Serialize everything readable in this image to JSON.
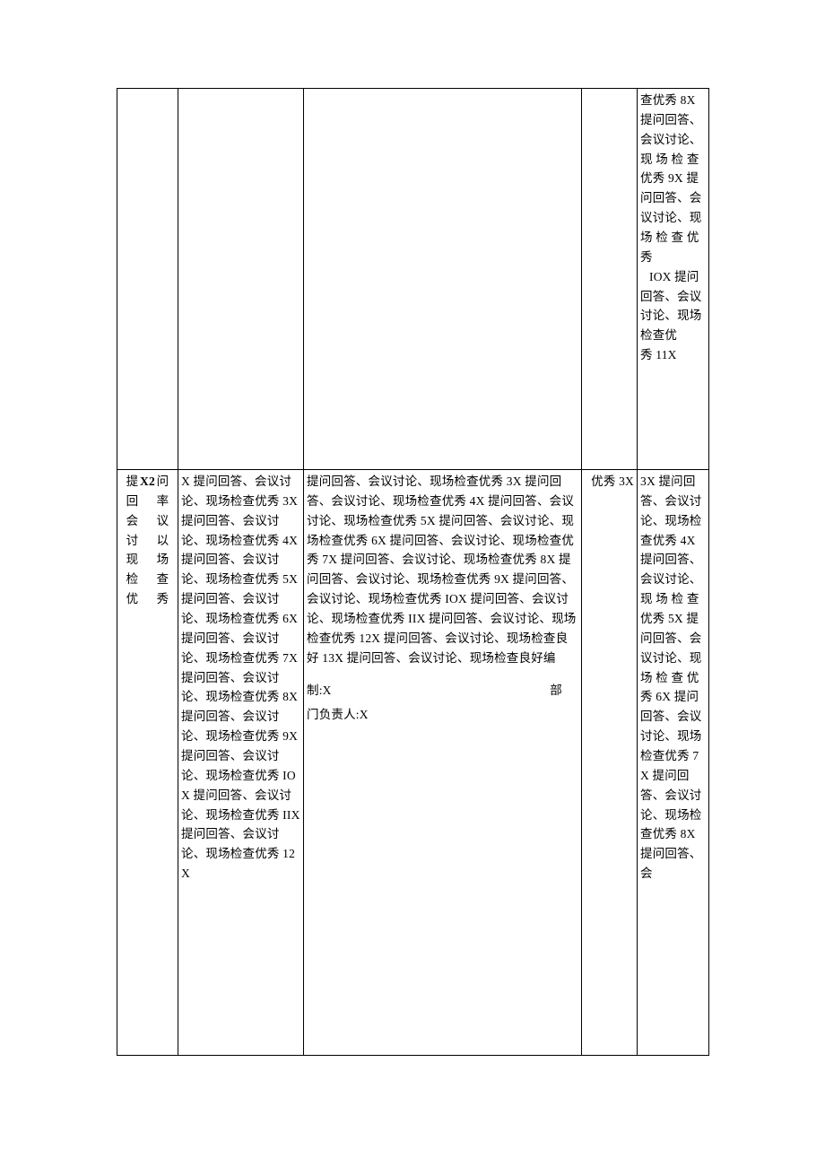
{
  "document": {
    "table": {
      "rows": [
        {
          "cells": {
            "col1": "",
            "col2": "",
            "col3": "",
            "col4": "",
            "col5_lines": [
              "查优秀 8X",
              "提问回答、",
              "会议讨论、",
              "现 场 检 查",
              "优秀 9X 提",
              "问回答、会",
              "议讨论、现",
              "场 检 查 优",
              "秀",
              "IOX 提问",
              "回答、会议",
              "讨论、现场",
              "检查优",
              "秀 11X"
            ]
          }
        },
        {
          "cells": {
            "col1_vertical": [
              "提回会讨现检优",
              "X2",
              "问率议以场查秀"
            ],
            "col2": "X 提问回答、会议讨论、现场检查优秀 3X 提问回答、会议讨论、现场检查优秀 4X 提问回答、会议讨论、现场检查优秀 5X 提问回答、会议讨论、现场检查优秀 6X 提问回答、会议讨论、现场检查优秀 7X 提问回答、会议讨论、现场检查优秀 8X 提问回答、会议讨论、现场检查优秀 9X 提问回答、会议讨论、现场检查优秀 IOX 提问回答、会议讨论、现场检查优秀 IIX 提问回答、会议讨论、现场检查优秀 12X",
            "col3": "提问回答、会议讨论、现场检查优秀 3X 提问回答、会议讨论、现场检查优秀 4X 提问回答、会议讨论、现场检查优秀 5X 提问回答、会议讨论、现场检查优秀 6X 提问回答、会议讨论、现场检查优秀 7X 提问回答、会议讨论、现场检查优秀 8X 提问回答、会议讨论、现场检查优秀 9X 提问回答、会议讨论、现场检查优秀 IOX 提问回答、会议讨论、现场检查优秀 IIX 提问回答、会议讨论、现场检查优秀 12X 提问回答、会议讨论、现场检查良好 13X 提问回答、会议讨论、现场检查良好编",
            "col3_sign_left": "制:X",
            "col3_sign_right": "部",
            "col3_sign_line2": "门负责人:X",
            "col4": "优秀 3X",
            "col5": "3X 提问回答、会议讨论、现场检查优秀 4X 提问回答、会议讨论、现 场 检 查优秀 5X 提问回答、会议讨论、现场 检 查 优秀 6X 提问回答、会议讨论、现场检查优秀 7X 提问回答、会议讨论、现场检查优秀 8X 提问回答、会"
          }
        }
      ]
    }
  }
}
